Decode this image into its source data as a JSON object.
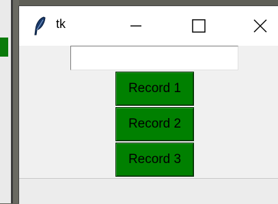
{
  "window": {
    "title": "tk",
    "icon": "tk-feather-icon"
  },
  "titlebar_controls": [
    {
      "name": "minimize-icon",
      "glyph": "—"
    },
    {
      "name": "maximize-icon",
      "glyph": "☐"
    },
    {
      "name": "close-icon",
      "glyph": "✕"
    }
  ],
  "entry": {
    "value": "",
    "placeholder": ""
  },
  "records": [
    {
      "label": "Record 1"
    },
    {
      "label": "Record 2"
    },
    {
      "label": "Record 3"
    }
  ],
  "colors": {
    "button_bg": "#008000",
    "window_bg": "#f0f0f0",
    "titlebar_bg": "#ffffff"
  }
}
